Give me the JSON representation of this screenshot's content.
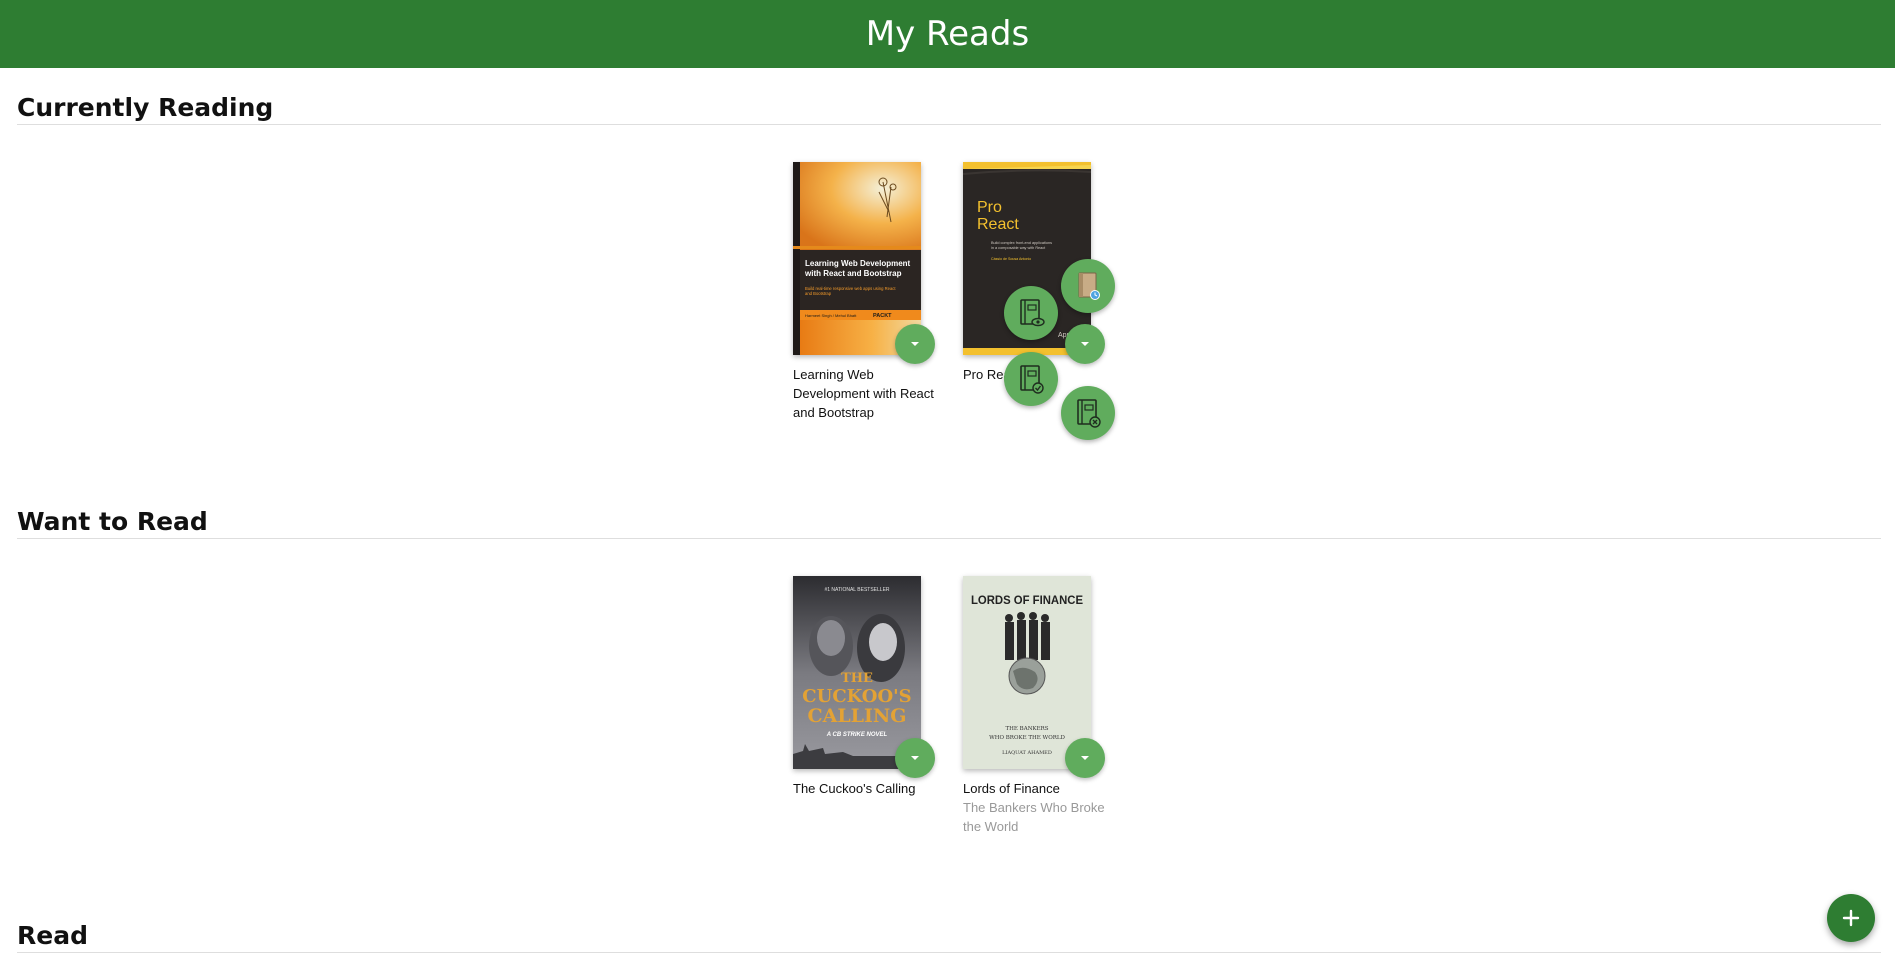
{
  "app": {
    "title": "My Reads"
  },
  "shelves": [
    {
      "title": "Currently Reading",
      "books": [
        {
          "title": "Learning Web Development with React and Bootstrap",
          "authors": "",
          "cover": {
            "heading": "Learning Web Development with React and Bootstrap",
            "tagline": "Build real-time responsive web apps using React and Bootstrap",
            "author_names": "Harmeet Singh / Mehul Bhatt",
            "publisher": "PACKT",
            "colors": {
              "top": "#f0a033",
              "band": "#2b2522",
              "strip": "#f08a1c"
            }
          }
        },
        {
          "title": "Pro React",
          "authors": "",
          "cover": {
            "heading_line1": "Pro",
            "heading_line2": "React",
            "tagline": "Build complex front-end applications in a composable way with React",
            "author_names": "Cássio de Sousa Antonio",
            "publisher": "Apress",
            "colors": {
              "bg": "#2a2624",
              "accent": "#f3c02e"
            }
          }
        }
      ]
    },
    {
      "title": "Want to Read",
      "books": [
        {
          "title": "The Cuckoo's Calling",
          "authors": "",
          "cover": {
            "top_line": "#1 NATIONAL BESTSELLER",
            "heading_line1": "THE",
            "heading_line2": "CUCKOO'S",
            "heading_line3": "CALLING",
            "series": "A CB STRIKE NOVEL",
            "colors": {
              "bg": "#6a6a6e",
              "title": "#e3a235"
            }
          }
        },
        {
          "title": "Lords of Finance",
          "authors": "The Bankers Who Broke the World",
          "cover": {
            "heading": "LORDS OF FINANCE",
            "subtitle_line1": "THE BANKERS",
            "subtitle_line2": "WHO BROKE THE WORLD",
            "author_names": "LIAQUAT AHAMED",
            "colors": {
              "bg": "#dfe5d8",
              "ink": "#222"
            }
          }
        }
      ]
    },
    {
      "title": "Read",
      "books": []
    }
  ],
  "shelf_menu": {
    "options": [
      {
        "name": "currently-reading",
        "icon": "book-clock-icon"
      },
      {
        "name": "want-to-read",
        "icon": "book-eye-icon"
      },
      {
        "name": "read",
        "icon": "book-check-icon"
      },
      {
        "name": "none",
        "icon": "book-remove-icon"
      }
    ]
  },
  "icons": {
    "changer": "caret-down-icon",
    "add": "plus-icon"
  },
  "colors": {
    "header": "#2e7d32",
    "button": "#60ac5d",
    "fab": "#2e7d32"
  }
}
